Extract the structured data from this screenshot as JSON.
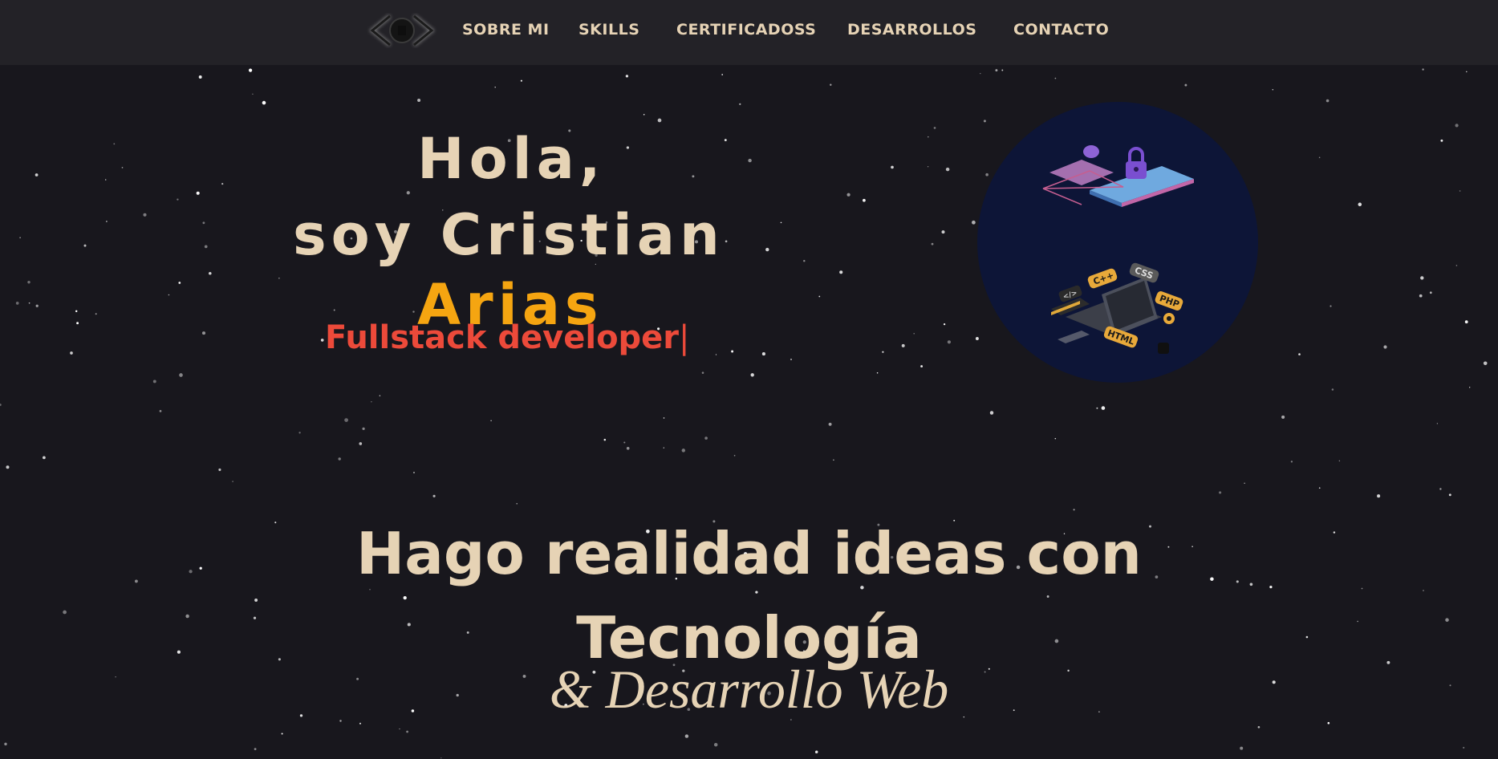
{
  "nav": {
    "logo_icon": "code-brackets-logo",
    "items": [
      {
        "label": "SOBRE MI"
      },
      {
        "label": "SKILLS"
      },
      {
        "label": "CERTIFICADOSS"
      },
      {
        "label": "DESARROLLOS"
      },
      {
        "label": "CONTACTO"
      }
    ]
  },
  "hero": {
    "greeting": "Hola,",
    "name_line": "soy Cristian",
    "surname": "Arias",
    "role": "Fullstack developer",
    "cursor": "|",
    "image_badges": [
      "C++",
      "CSS",
      "PHP",
      "HTML",
      "</>"
    ]
  },
  "tagline": {
    "line1": "Hago realidad ideas con",
    "line2": "Tecnología",
    "subline": "& Desarrollo Web"
  },
  "colors": {
    "background": "#18171d",
    "navbar": "#232227",
    "text": "#e6d3b5",
    "accent_orange": "#f5a511",
    "accent_red": "#ec4a3a",
    "image_circle": "#0d1537"
  }
}
